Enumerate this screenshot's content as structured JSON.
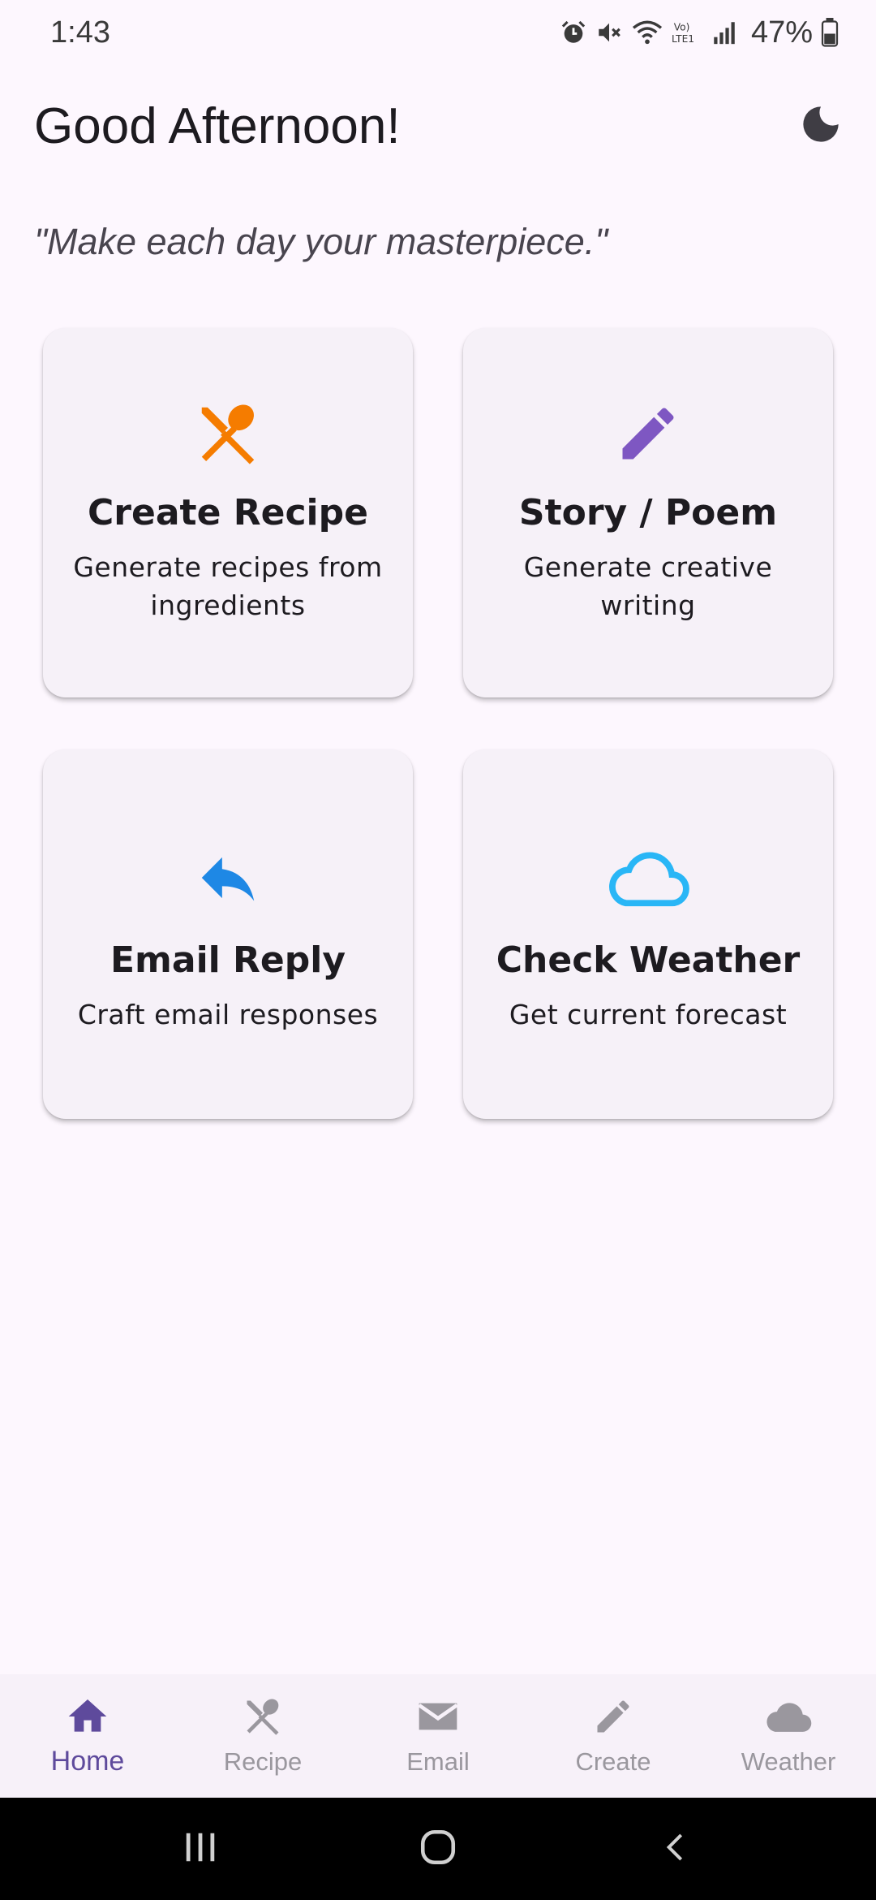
{
  "status_bar": {
    "time": "1:43",
    "battery_percent": "47%",
    "icons": [
      "alarm-icon",
      "mute-icon",
      "wifi-icon",
      "volte-icon",
      "signal-icon",
      "battery-icon"
    ]
  },
  "header": {
    "greeting": "Good Afternoon!",
    "theme_icon": "moon-icon"
  },
  "quote": "\"Make each day your masterpiece.\"",
  "cards": [
    {
      "title": "Create Recipe",
      "description": "Generate recipes from ingredients",
      "icon": "utensils-icon",
      "icon_color": "#F57C00"
    },
    {
      "title": "Story / Poem",
      "description": "Generate creative writing",
      "icon": "pencil-icon",
      "icon_color": "#7E57C2"
    },
    {
      "title": "Email Reply",
      "description": "Craft email responses",
      "icon": "reply-icon",
      "icon_color": "#1E88E5"
    },
    {
      "title": "Check Weather",
      "description": "Get current forecast",
      "icon": "cloud-icon",
      "icon_color": "#29B6F6"
    }
  ],
  "bottom_nav": {
    "items": [
      {
        "label": "Home",
        "icon": "home-icon",
        "active": true
      },
      {
        "label": "Recipe",
        "icon": "utensils-icon",
        "active": false
      },
      {
        "label": "Email",
        "icon": "mail-icon",
        "active": false
      },
      {
        "label": "Create",
        "icon": "pencil-icon",
        "active": false
      },
      {
        "label": "Weather",
        "icon": "cloud-icon",
        "active": false
      }
    ],
    "active_color": "#5E4A9C",
    "inactive_color": "#9A979E"
  },
  "system_nav": {
    "buttons": [
      "recents-icon",
      "home-circle-icon",
      "back-icon"
    ]
  }
}
